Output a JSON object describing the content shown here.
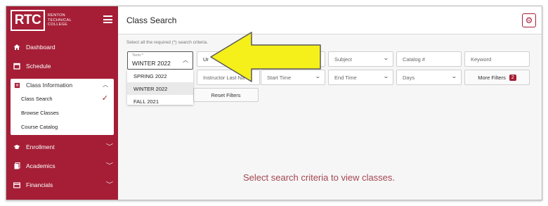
{
  "logo": {
    "abbr": "RTC",
    "name_line1": "RENTON",
    "name_line2": "TECHNICAL",
    "name_line3": "COLLEGE"
  },
  "sidebar": {
    "items": [
      {
        "label": "Dashboard",
        "icon": "home-icon"
      },
      {
        "label": "Schedule",
        "icon": "calendar-icon"
      },
      {
        "label": "Class Information",
        "icon": "book-icon"
      },
      {
        "label": "Enrollment",
        "icon": "graduation-cap-icon"
      },
      {
        "label": "Academics",
        "icon": "document-icon"
      },
      {
        "label": "Financials",
        "icon": "credit-card-icon"
      }
    ],
    "class_info_subitems": [
      {
        "label": "Class Search"
      },
      {
        "label": "Browse Classes"
      },
      {
        "label": "Course Catalog"
      }
    ]
  },
  "header": {
    "title": "Class Search"
  },
  "search": {
    "hint": "Select all the required (*) search criteria.",
    "term": {
      "label": "Term *",
      "value": "WINTER 2022",
      "options": [
        "SPRING 2022",
        "WINTER 2022",
        "FALL 2021"
      ]
    },
    "row1": {
      "institution_value": "Ur",
      "subject_placeholder": "Subject",
      "catalog_placeholder": "Catalog #",
      "keyword_placeholder": "Keyword"
    },
    "row2": {
      "instructor_placeholder": "Instructor Last Na",
      "start_time": "Start Time",
      "end_time": "End Time",
      "days": "Days",
      "more_filters": "More Filters",
      "more_filters_count": "2"
    },
    "reset_label": "Reset Filters"
  },
  "empty_message": "Select search criteria to view classes.",
  "colors": {
    "brand": "#a51e36",
    "arrow_fill": "#f5ef1a",
    "arrow_stroke": "#5a5a5a"
  }
}
